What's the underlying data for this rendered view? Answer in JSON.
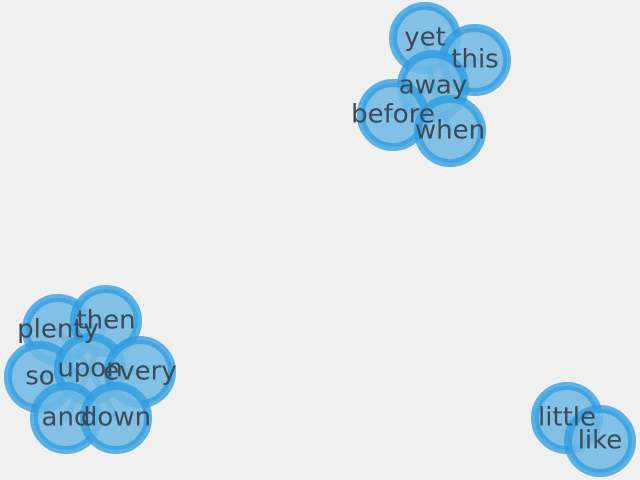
{
  "graph": {
    "background": "#f0f0f0",
    "node_fill": "#6fb8e3",
    "node_stroke": "#2b9be0",
    "edge_color": "#1f8fd0",
    "label_color": "#3a4a5a",
    "nodes": [
      {
        "id": "yet",
        "label": "yet"
      },
      {
        "id": "this",
        "label": "this"
      },
      {
        "id": "away",
        "label": "away"
      },
      {
        "id": "before",
        "label": "before"
      },
      {
        "id": "when",
        "label": "when"
      },
      {
        "id": "plenty",
        "label": "plenty"
      },
      {
        "id": "then",
        "label": "then"
      },
      {
        "id": "so",
        "label": "so"
      },
      {
        "id": "upon",
        "label": "upon"
      },
      {
        "id": "every",
        "label": "every"
      },
      {
        "id": "and",
        "label": "and"
      },
      {
        "id": "down",
        "label": "down"
      },
      {
        "id": "little",
        "label": "little"
      },
      {
        "id": "like",
        "label": "like"
      }
    ],
    "edges": [
      [
        "away",
        "yet"
      ],
      [
        "away",
        "this"
      ],
      [
        "away",
        "before"
      ],
      [
        "away",
        "when"
      ],
      [
        "upon",
        "plenty"
      ],
      [
        "upon",
        "then"
      ],
      [
        "upon",
        "so"
      ],
      [
        "upon",
        "every"
      ],
      [
        "upon",
        "and"
      ],
      [
        "upon",
        "down"
      ],
      [
        "little",
        "like"
      ]
    ]
  }
}
